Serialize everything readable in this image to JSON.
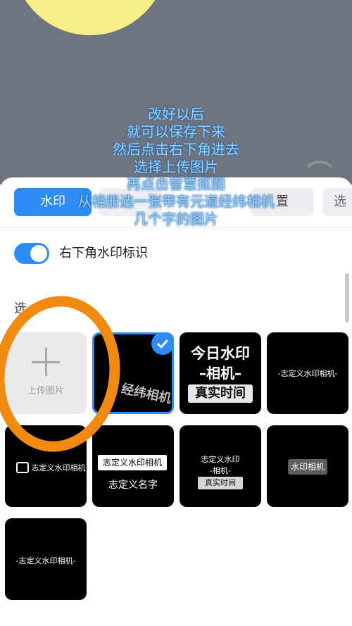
{
  "tabs": [
    {
      "label": "水印"
    },
    {
      "label": ""
    },
    {
      "label": ""
    },
    {
      "label": "置"
    },
    {
      "label": "选"
    }
  ],
  "toggle": {
    "label": "右下角水印标识",
    "on": true
  },
  "section_title": "选",
  "upload_tile": {
    "label": "上传图片"
  },
  "templates": {
    "t2_text": "经纬相机",
    "t3": {
      "line1": "今日水印",
      "line2": "–相机–",
      "badge": "真实时间"
    },
    "t4": {
      "text": "-志定义水印相机-"
    },
    "t6": {
      "text": "志定义水印相机"
    },
    "t7": {
      "box": "志定义水印相机",
      "name": "志定义名字"
    },
    "t8": {
      "line1": "志定义水印",
      "line2": "-相机-",
      "badge": "真实时间"
    },
    "t9": {
      "text": "水印相机"
    },
    "t10": {
      "text": "-志定义水印相机-"
    }
  },
  "overlay_lines": [
    "改好以后",
    "就可以保存下来",
    "然后点击右下角进去",
    "选择上传图片",
    "再点击智慧抠图",
    "从相册选一张带有元道经纬相机",
    "几个字的图片"
  ],
  "colors": {
    "accent": "#2f8cf5",
    "annotation_circle": "#f28a12",
    "overlay_text": "#8fd5ff",
    "top_bg": "#6f757f"
  }
}
